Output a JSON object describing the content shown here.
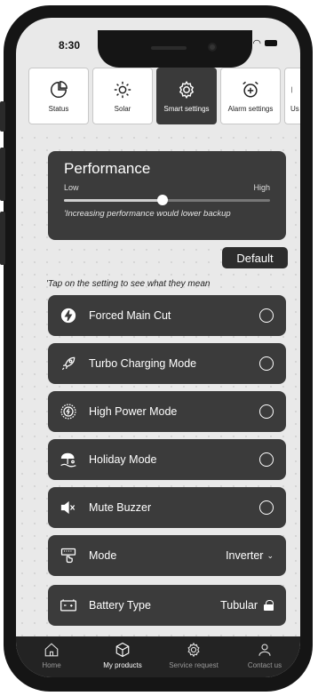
{
  "status_bar": {
    "time": "8:30"
  },
  "tabs": [
    {
      "label": "Status",
      "icon": "pie-chart-icon",
      "active": false
    },
    {
      "label": "Solar",
      "icon": "sun-icon",
      "active": false
    },
    {
      "label": "Smart settings",
      "icon": "gear-icon",
      "active": true
    },
    {
      "label": "Alarm settings",
      "icon": "alarm-clock-icon",
      "active": false
    },
    {
      "label": "Us tr",
      "icon": "partial-icon",
      "active": false
    }
  ],
  "performance": {
    "title": "Performance",
    "low_label": "Low",
    "high_label": "High",
    "level": 0.48,
    "note": "'Increasing performance would lower backup"
  },
  "default_button": "Default",
  "tap_hint": "'Tap on the setting to see what they mean",
  "settings": [
    {
      "label": "Forced Main Cut",
      "icon": "power-cut-icon",
      "control": "radio"
    },
    {
      "label": "Turbo Charging Mode",
      "icon": "rocket-icon",
      "control": "radio"
    },
    {
      "label": "High Power Mode",
      "icon": "high-power-icon",
      "control": "radio"
    },
    {
      "label": "Holiday Mode",
      "icon": "beach-umbrella-icon",
      "control": "radio"
    },
    {
      "label": "Mute Buzzer",
      "icon": "mute-speaker-icon",
      "control": "radio"
    },
    {
      "label": "Mode",
      "icon": "mode-switch-icon",
      "control": "select",
      "value": "Inverter"
    },
    {
      "label": "Battery Type",
      "icon": "battery-icon",
      "control": "locked",
      "value": "Tubular"
    }
  ],
  "bottom_nav": [
    {
      "label": "Home",
      "icon": "home-icon",
      "active": false
    },
    {
      "label": "My products",
      "icon": "box-icon",
      "active": true
    },
    {
      "label": "Service request",
      "icon": "gear-icon",
      "active": false
    },
    {
      "label": "Contact us",
      "icon": "person-icon",
      "active": false
    }
  ],
  "colors": {
    "card_bg": "#3b3b3b",
    "screen_bg": "#e9e9e9",
    "nav_bg": "#232323",
    "frame": "#151515"
  }
}
